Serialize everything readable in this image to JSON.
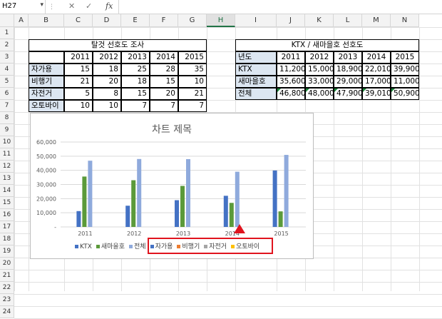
{
  "formula_bar": {
    "name_box": "H27",
    "cancel_glyph": "✕",
    "confirm_glyph": "✓",
    "fx_label": "fx",
    "formula": ""
  },
  "columns": [
    "A",
    "B",
    "C",
    "D",
    "E",
    "F",
    "G",
    "H",
    "I",
    "J",
    "K",
    "L",
    "M",
    "N"
  ],
  "selected_column": "H",
  "rows": [
    "1",
    "2",
    "3",
    "4",
    "5",
    "6",
    "7",
    "8",
    "9",
    "10",
    "11",
    "12",
    "13",
    "14",
    "15",
    "16",
    "17",
    "18",
    "19",
    "20",
    "21",
    "22",
    "23",
    "24"
  ],
  "table1": {
    "title": "탈것 선호도 조사",
    "years": [
      "2011",
      "2012",
      "2013",
      "2014",
      "2015"
    ],
    "rows": [
      {
        "label": "자가용",
        "values": [
          "15",
          "18",
          "25",
          "28",
          "35"
        ]
      },
      {
        "label": "비행기",
        "values": [
          "21",
          "20",
          "18",
          "15",
          "10"
        ]
      },
      {
        "label": "자전거",
        "values": [
          "5",
          "8",
          "15",
          "20",
          "21"
        ]
      },
      {
        "label": "오토바이",
        "values": [
          "10",
          "10",
          "7",
          "7",
          "7"
        ]
      }
    ]
  },
  "table2": {
    "title": "KTX / 새마을호 선호도",
    "header_label": "년도",
    "years": [
      "2011",
      "2012",
      "2013",
      "2014",
      "2015"
    ],
    "rows": [
      {
        "label": "KTX",
        "values": [
          "11,200",
          "15,000",
          "18,900",
          "22,010",
          "39,900"
        ]
      },
      {
        "label": "새마을호",
        "values": [
          "35,600",
          "33,000",
          "29,000",
          "17,000",
          "11,000"
        ]
      },
      {
        "label": "전체",
        "values": [
          "46,800",
          "48,000",
          "47,900",
          "39,010",
          "50,900"
        ]
      }
    ]
  },
  "chart_data": {
    "type": "bar",
    "title": "차트 제목",
    "categories": [
      "2011",
      "2012",
      "2013",
      "2014",
      "2015"
    ],
    "ylim": [
      0,
      60000
    ],
    "yticks": [
      "-",
      "10,000",
      "20,000",
      "30,000",
      "40,000",
      "50,000",
      "60,000"
    ],
    "grid": true,
    "legend_position": "bottom",
    "series": [
      {
        "name": "KTX",
        "color": "#4472c4",
        "values": [
          11200,
          15000,
          18900,
          22010,
          39900
        ]
      },
      {
        "name": "새마을호",
        "color": "#5b9a3a",
        "values": [
          35600,
          33000,
          29000,
          17000,
          11000
        ]
      },
      {
        "name": "전체",
        "color": "#8faadc",
        "values": [
          46800,
          48000,
          47900,
          39010,
          50900
        ]
      },
      {
        "name": "자가용",
        "color": "#4472c4",
        "values": [
          15,
          18,
          25,
          28,
          35
        ]
      },
      {
        "name": "비행기",
        "color": "#ed7d31",
        "values": [
          21,
          20,
          18,
          15,
          10
        ]
      },
      {
        "name": "자전거",
        "color": "#a5a5a5",
        "values": [
          5,
          8,
          15,
          20,
          21
        ]
      },
      {
        "name": "오토바이",
        "color": "#ffc000",
        "values": [
          10,
          10,
          7,
          7,
          7
        ]
      }
    ]
  },
  "colors": {
    "highlight": "#e0141e",
    "label_fill": "#dce6f1",
    "flag": "#1a8a3a"
  }
}
